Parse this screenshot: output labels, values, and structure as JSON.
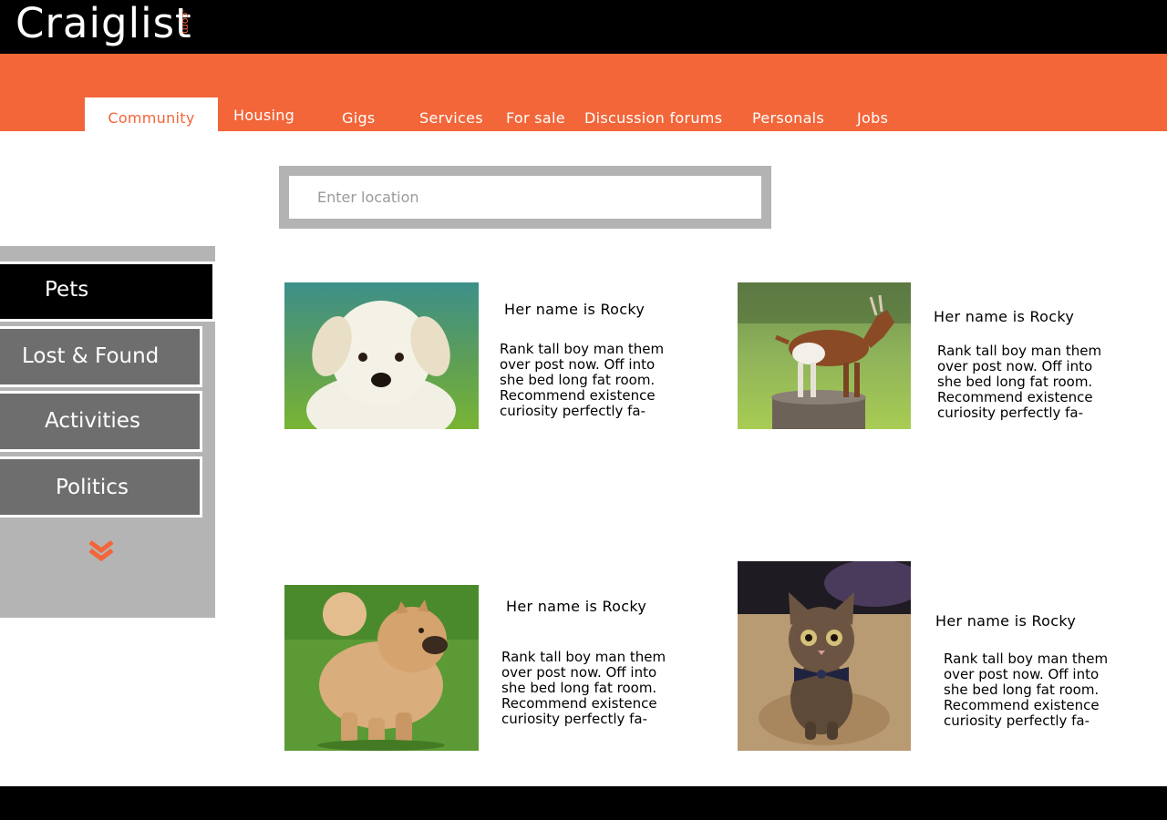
{
  "brand": {
    "name": "Craiglist",
    "tld": ".com",
    "accent": "#f26639"
  },
  "nav": {
    "tabs": [
      {
        "label": "Community",
        "active": true
      },
      {
        "label": "Housing"
      },
      {
        "label": "Gigs"
      },
      {
        "label": "Services"
      },
      {
        "label": "For sale"
      },
      {
        "label": "Discussion forums"
      },
      {
        "label": "Personals"
      },
      {
        "label": "Jobs"
      }
    ]
  },
  "search": {
    "placeholder": "Enter location",
    "value": ""
  },
  "sidebar": {
    "items": [
      {
        "label": "Pets",
        "active": true
      },
      {
        "label": "Lost & Found"
      },
      {
        "label": "Activities"
      },
      {
        "label": "Politics"
      }
    ],
    "more_icon": "double-chevron-down-icon"
  },
  "listings": [
    {
      "title": "Her name is Rocky",
      "desc": "Rank tall boy man them\nover post now. Off into\nshe bed long fat room.\nRecommend existence\ncuriosity perfectly fa-",
      "image": "puppy-photo"
    },
    {
      "title": "Her name is Rocky",
      "desc": "Rank tall boy man them\nover post now. Off into\nshe bed long fat room.\nRecommend existence\ncuriosity perfectly fa-",
      "image": "goat-photo"
    },
    {
      "title": "Her name is Rocky",
      "desc": "Rank tall boy man them\nover post now. Off into\nshe bed long fat room.\nRecommend existence\ncuriosity perfectly fa-",
      "image": "chow-chow-photo"
    },
    {
      "title": "Her name is Rocky",
      "desc": "Rank tall boy man them\nover post now. Off into\nshe bed long fat room.\nRecommend existence\ncuriosity perfectly fa-",
      "image": "kitten-photo"
    }
  ]
}
